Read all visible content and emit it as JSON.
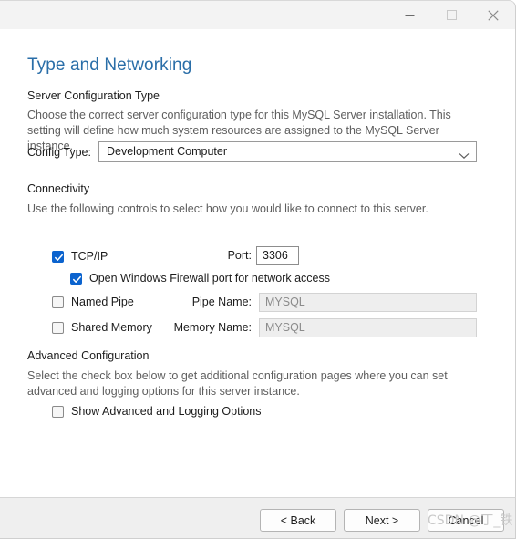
{
  "window": {
    "controls": {
      "minimize": "minimize-icon",
      "maximize": "maximize-icon",
      "close": "close-icon"
    }
  },
  "page": {
    "title": "Type and Networking"
  },
  "server_configuration_type": {
    "heading": "Server Configuration Type",
    "description": "Choose the correct server configuration type for this MySQL Server installation. This setting will define how much system resources are assigned to the MySQL Server instance.",
    "config_type_label": "Config Type:",
    "config_type_value": "Development Computer"
  },
  "connectivity": {
    "heading": "Connectivity",
    "description": "Use the following controls to select how you would like to connect to this server.",
    "tcpip": {
      "label": "TCP/IP",
      "checked": true
    },
    "port": {
      "label": "Port:",
      "value": "3306"
    },
    "firewall": {
      "label": "Open Windows Firewall port for network access",
      "checked": true
    },
    "named_pipe": {
      "label": "Named Pipe",
      "checked": false
    },
    "pipe_name": {
      "label": "Pipe Name:",
      "value": "MYSQL"
    },
    "shared_memory": {
      "label": "Shared Memory",
      "checked": false
    },
    "memory_name": {
      "label": "Memory Name:",
      "value": "MYSQL"
    }
  },
  "advanced_configuration": {
    "heading": "Advanced Configuration",
    "description": "Select the check box below to get additional configuration pages where you can set advanced and logging options for this server instance.",
    "show_advanced": {
      "label": "Show Advanced and Logging Options",
      "checked": false
    }
  },
  "footer": {
    "back_label": "< Back",
    "next_label": "Next >",
    "cancel_label": "Cancel"
  },
  "watermark": {
    "text": "CSDN @丁_铁"
  },
  "colors": {
    "title_blue": "#2a6ea8",
    "checkbox_accent": "#0b63ce",
    "titlebar_bg": "#f3f3f3",
    "footer_bg": "#efefef",
    "disabled_input_bg": "#eeeeee"
  }
}
